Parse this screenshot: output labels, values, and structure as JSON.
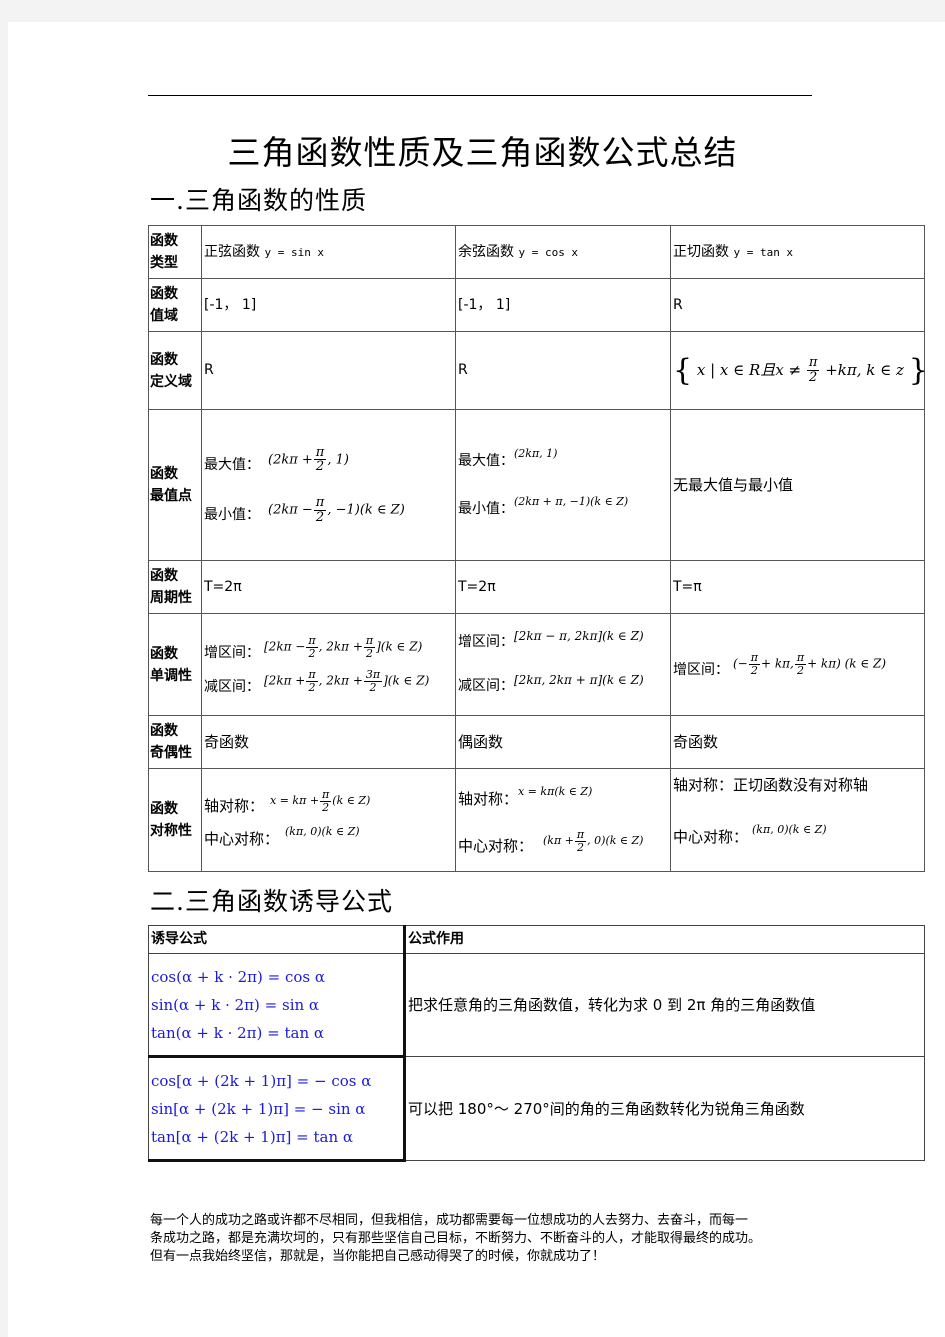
{
  "document": {
    "title": "三角函数性质及三角函数公式总结",
    "section1_title": "一.三角函数的性质",
    "section2_title": "二.三角函数诱导公式"
  },
  "properties_table": {
    "rows": [
      {
        "header": [
          "函数",
          "类型"
        ],
        "sin": "正弦函数",
        "sin_eq": "y = sin x",
        "cos": "余弦函数",
        "cos_eq": "y = cos x",
        "tan": "正切函数",
        "tan_eq": "y = tan x"
      },
      {
        "header": [
          "函数",
          "值域"
        ],
        "sin": "[-1， 1]",
        "cos": "[-1， 1]",
        "tan": "R"
      },
      {
        "header": [
          "函数",
          "定义域"
        ],
        "sin": "R",
        "cos": "R",
        "tan": {
          "lbrace": "{",
          "pre": "x | x ∈ R且x ≠ ",
          "frac_num": "π",
          "frac_den": "2",
          "post": "+kπ, k ∈ z",
          "rbrace": "}"
        }
      },
      {
        "header": [
          "函数",
          "最值点"
        ],
        "sin": {
          "max_label": "最大值：",
          "max_pre": "(2kπ +",
          "max_num": "π",
          "max_den": "2",
          "max_post": ", 1)",
          "min_label": "最小值：",
          "min_pre": "(2kπ −",
          "min_num": "π",
          "min_den": "2",
          "min_post": ", −1)(k ∈ Z)"
        },
        "cos": {
          "max_label": "最大值：",
          "max": "(2kπ, 1)",
          "min_label": "最小值：",
          "min": "(2kπ + π, −1)(k ∈ Z)"
        },
        "tan": "无最大值与最小值"
      },
      {
        "header": [
          "函数",
          "周期性"
        ],
        "sin": "T=2π",
        "cos": "T=2π",
        "tan": "T=π"
      },
      {
        "header": [
          "函数",
          "单调性"
        ],
        "sin": {
          "inc_label": "增区间：",
          "inc_a": "[2kπ −",
          "inc_a_num": "π",
          "inc_a_den": "2",
          "inc_b": ", 2kπ +",
          "inc_b_num": "π",
          "inc_b_den": "2",
          "inc_c": "](k ∈ Z)",
          "dec_label": "减区间：",
          "dec_a": "[2kπ +",
          "dec_a_num": "π",
          "dec_a_den": "2",
          "dec_b": ", 2kπ +",
          "dec_b_num": "3π",
          "dec_b_den": "2",
          "dec_c": "](k ∈ Z)"
        },
        "cos": {
          "inc_label": "增区间：",
          "inc": "[2kπ − π, 2kπ](k ∈ Z)",
          "dec_label": "减区间：",
          "dec": "[2kπ, 2kπ + π](k ∈ Z)"
        },
        "tan": {
          "inc_label": "增区间：",
          "a": "(−",
          "a_num": "π",
          "a_den": "2",
          "b": "+ kπ,",
          "b_num": "π",
          "b_den": "2",
          "c": "+ kπ)  (k ∈ Z)"
        }
      },
      {
        "header": [
          "函数",
          "奇偶性"
        ],
        "sin": "奇函数",
        "cos": "偶函数",
        "tan": "奇函数"
      },
      {
        "header": [
          "函数",
          "对称性"
        ],
        "sin": {
          "axis_label": "轴对称：",
          "axis_pre": "x = kπ +",
          "axis_num": "π",
          "axis_den": "2",
          "axis_post": "(k ∈ Z)",
          "center_label": "中心对称：",
          "center": "(kπ, 0)(k ∈ Z)"
        },
        "cos": {
          "axis_label": "轴对称：",
          "axis": "x = kπ(k ∈ Z)",
          "center_label": "中心对称：",
          "center_pre": "(kπ +",
          "center_num": "π",
          "center_den": "2",
          "center_post": ", 0)(k ∈ Z)"
        },
        "tan": {
          "axis_label": "轴对称：",
          "axis_text": "正切函数没有对称轴",
          "center_label": "中心对称：",
          "center": "(kπ, 0)(k ∈ Z)"
        }
      }
    ]
  },
  "induction_table": {
    "headers": [
      "诱导公式",
      "公式作用"
    ],
    "rows": [
      {
        "formulas": [
          "cos(α + k · 2π) = cos α",
          "sin(α + k · 2π) = sin α",
          "tan(α + k · 2π) = tan α"
        ],
        "usage": "把求任意角的三角函数值，转化为求 0 到 2π 角的三角函数值"
      },
      {
        "formulas": [
          "cos[α + (2k + 1)π] = − cos α",
          "sin[α + (2k + 1)π] = − sin α",
          "tan[α + (2k + 1)π] = tan α"
        ],
        "usage": "可以把 180°～ 270°间的角的三角函数转化为锐角三角函数"
      }
    ],
    "formula_color": "#1a1ad8"
  },
  "footer": {
    "lines": [
      "每一个人的成功之路或许都不尽相同，但我相信，成功都需要每一位想成功的人去努力、去奋斗，而每一",
      "条成功之路，都是充满坎坷的，只有那些坚信自己目标，不断努力、不断奋斗的人，才能取得最终的成功。",
      "但有一点我始终坚信，那就是，当你能把自己感动得哭了的时候，你就成功了！"
    ]
  }
}
